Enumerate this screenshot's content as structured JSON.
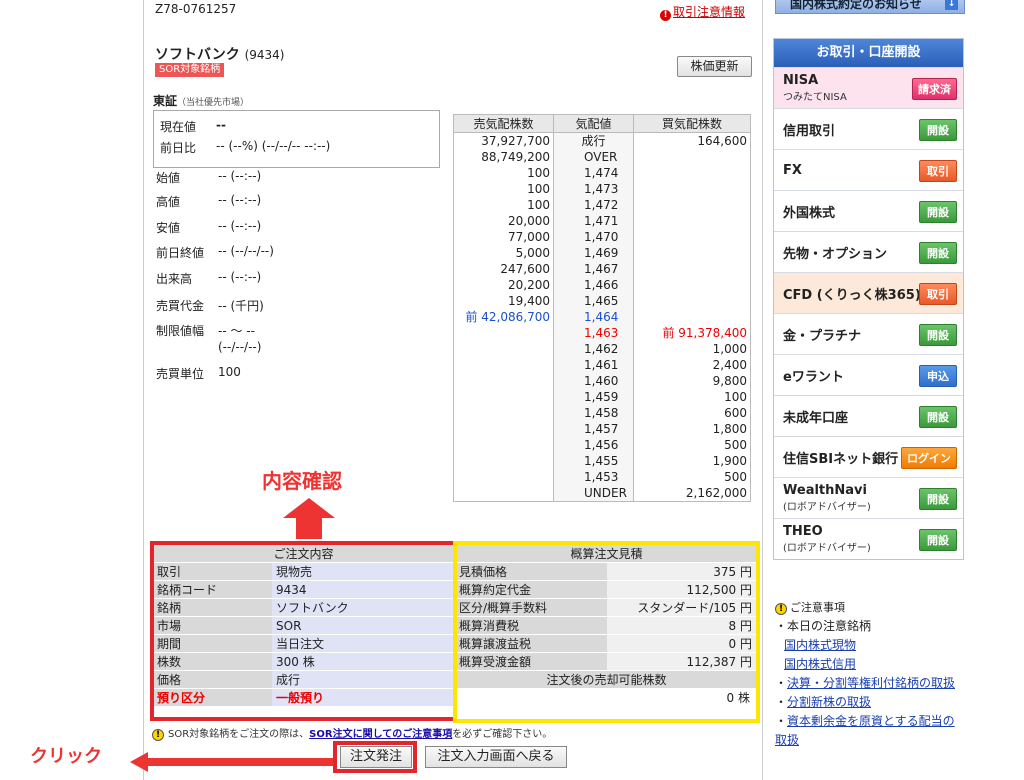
{
  "order_id": "Z78-0761257",
  "caution_link": "取引注意情報",
  "stock": {
    "name": "ソフトバンク",
    "code": "(9434)",
    "badge": "SOR対象銘柄"
  },
  "refresh_label": "株価更新",
  "market": {
    "name": "東証",
    "note": "（当社優先市場）"
  },
  "price": {
    "current_label": "現在値",
    "current_value": "--",
    "change_label": "前日比",
    "change_value": "-- (--%) (--/--/-- --:--)"
  },
  "info": [
    {
      "label": "始値",
      "value": "-- (--:--)"
    },
    {
      "label": "高値",
      "value": "-- (--:--)"
    },
    {
      "label": "安値",
      "value": "-- (--:--)"
    },
    {
      "label": "前日終値",
      "value": "-- (--/--/--)"
    },
    {
      "label": "出来高",
      "value": "-- (--:--)"
    },
    {
      "label": "売買代金",
      "value": "-- (千円)"
    },
    {
      "label": "制限値幅",
      "value": "-- 〜 --"
    },
    {
      "label": "",
      "value": "(--/--/--)"
    },
    {
      "label": "売買単位",
      "value": "100"
    }
  ],
  "board": {
    "headers": [
      "売気配株数",
      "気配値",
      "買気配株数"
    ],
    "rows": [
      {
        "sell": "37,927,700",
        "price": "成行",
        "buy": "164,600",
        "center": true
      },
      {
        "sell": "88,749,200",
        "price": "OVER",
        "buy": ""
      },
      {
        "sell": "100",
        "price": "1,474",
        "buy": ""
      },
      {
        "sell": "100",
        "price": "1,473",
        "buy": ""
      },
      {
        "sell": "100",
        "price": "1,472",
        "buy": ""
      },
      {
        "sell": "20,000",
        "price": "1,471",
        "buy": ""
      },
      {
        "sell": "77,000",
        "price": "1,470",
        "buy": ""
      },
      {
        "sell": "5,000",
        "price": "1,469",
        "buy": ""
      },
      {
        "sell": "247,600",
        "price": "1,467",
        "buy": ""
      },
      {
        "sell": "20,200",
        "price": "1,466",
        "buy": ""
      },
      {
        "sell": "19,400",
        "price": "1,465",
        "buy": ""
      },
      {
        "sell": "前 42,086,700",
        "price": "1,464",
        "buy": "",
        "style": "blue"
      },
      {
        "sell": "",
        "price": "1,463",
        "buy": "前 91,378,400",
        "style": "red"
      },
      {
        "sell": "",
        "price": "1,462",
        "buy": "1,000"
      },
      {
        "sell": "",
        "price": "1,461",
        "buy": "2,400"
      },
      {
        "sell": "",
        "price": "1,460",
        "buy": "9,800"
      },
      {
        "sell": "",
        "price": "1,459",
        "buy": "100"
      },
      {
        "sell": "",
        "price": "1,458",
        "buy": "600"
      },
      {
        "sell": "",
        "price": "1,457",
        "buy": "1,800"
      },
      {
        "sell": "",
        "price": "1,456",
        "buy": "500"
      },
      {
        "sell": "",
        "price": "1,455",
        "buy": "1,900"
      },
      {
        "sell": "",
        "price": "1,453",
        "buy": "500"
      },
      {
        "sell": "",
        "price": "UNDER",
        "buy": "2,162,000"
      }
    ]
  },
  "annotation_top": "内容確認",
  "annotation_click": "クリック",
  "order_details": {
    "title": "ご注文内容",
    "rows": [
      {
        "k": "取引",
        "v": "現物売"
      },
      {
        "k": "銘柄コード",
        "v": "9434"
      },
      {
        "k": "銘柄",
        "v": "ソフトバンク"
      },
      {
        "k": "市場",
        "v": "SOR"
      },
      {
        "k": "期間",
        "v": "当日注文"
      },
      {
        "k": "株数",
        "v": "300 株"
      },
      {
        "k": "価格",
        "v": "成行"
      },
      {
        "k": "預り区分",
        "v": "一般預り",
        "hl": true
      }
    ]
  },
  "estimate": {
    "title": "概算注文見積",
    "rows": [
      {
        "k": "見積価格",
        "v": "375 円"
      },
      {
        "k": "概算約定代金",
        "v": "112,500 円"
      },
      {
        "k": "区分/概算手数料",
        "v": "スタンダード/105 円"
      },
      {
        "k": "概算消費税",
        "v": "8 円"
      },
      {
        "k": "概算譲渡益税",
        "v": "0 円"
      },
      {
        "k": "概算受渡金額",
        "v": "112,387 円"
      }
    ],
    "sub_title": "注文後の売却可能株数",
    "sub_value": "0 株"
  },
  "note": {
    "pre": "SOR対象銘柄をご注文の際は、",
    "link": "SOR注文に関してのご注意事項",
    "post": "を必ずご確認下さい。"
  },
  "submit_label": "注文発注",
  "back_label": "注文入力画面へ戻る",
  "top_banner": "国内株式約定のお知らせ",
  "side": {
    "title": "お取引・口座開設",
    "items": [
      {
        "label": "NISA",
        "sub": "つみたてNISA",
        "tag": "請求済",
        "color": "p",
        "bg": "pink"
      },
      {
        "label": "信用取引",
        "tag": "開設",
        "color": "g"
      },
      {
        "label": "FX",
        "tag": "取引",
        "color": "o"
      },
      {
        "label": "外国株式",
        "tag": "開設",
        "color": "g"
      },
      {
        "label": "先物・オプション",
        "tag": "開設",
        "color": "g"
      },
      {
        "label": "CFD (くりっく株365)",
        "tag": "取引",
        "color": "o",
        "bg": "orange"
      },
      {
        "label": "金・プラチナ",
        "tag": "開設",
        "color": "g"
      },
      {
        "label": "eワラント",
        "tag": "申込",
        "color": "b"
      },
      {
        "label": "未成年口座",
        "tag": "開設",
        "color": "g"
      },
      {
        "label": "住信SBIネット銀行",
        "tag": "ログイン",
        "color": "y"
      },
      {
        "label": "WealthNavi",
        "sub": "(ロボアドバイザー)",
        "tag": "開設",
        "color": "g"
      },
      {
        "label": "THEO",
        "sub": "(ロボアドバイザー)",
        "tag": "開設",
        "color": "g"
      }
    ]
  },
  "notice": {
    "title": "ご注意事項",
    "lines": [
      {
        "text": "・本日の注意銘柄",
        "link": false
      },
      {
        "text": "国内株式現物",
        "link": true
      },
      {
        "text": "国内株式信用",
        "link": true
      },
      {
        "text": "・決算・分割等権利付銘柄の取扱",
        "link": true
      },
      {
        "text": "・分割新株の取扱",
        "link": true
      },
      {
        "text": "・資本剰余金を原資とする配当の取扱",
        "link": true
      }
    ]
  }
}
